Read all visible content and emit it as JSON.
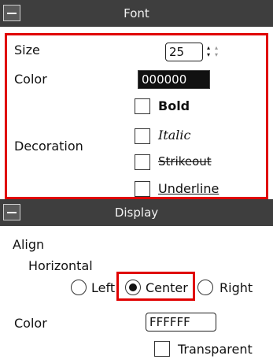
{
  "font_panel": {
    "title": "Font",
    "size_label": "Size",
    "size_value": "25",
    "color_label": "Color",
    "color_value": "000000",
    "decoration_label": "Decoration",
    "decorations": [
      {
        "label": "Bold",
        "checked": false
      },
      {
        "label": "Italic",
        "checked": false
      },
      {
        "label": "Strikeout",
        "checked": false
      },
      {
        "label": "Underline",
        "checked": false
      }
    ]
  },
  "display_panel": {
    "title": "Display",
    "align_label": "Align",
    "horizontal_label": "Horizontal",
    "align_options": [
      {
        "label": "Left",
        "selected": false
      },
      {
        "label": "Center",
        "selected": true
      },
      {
        "label": "Right",
        "selected": false
      }
    ],
    "color_label": "Color",
    "color_value": "FFFFFF",
    "transparent_label": "Transparent",
    "transparent_checked": false
  },
  "colors": {
    "header_bg": "#3e3e3e",
    "highlight": "#e00000"
  }
}
